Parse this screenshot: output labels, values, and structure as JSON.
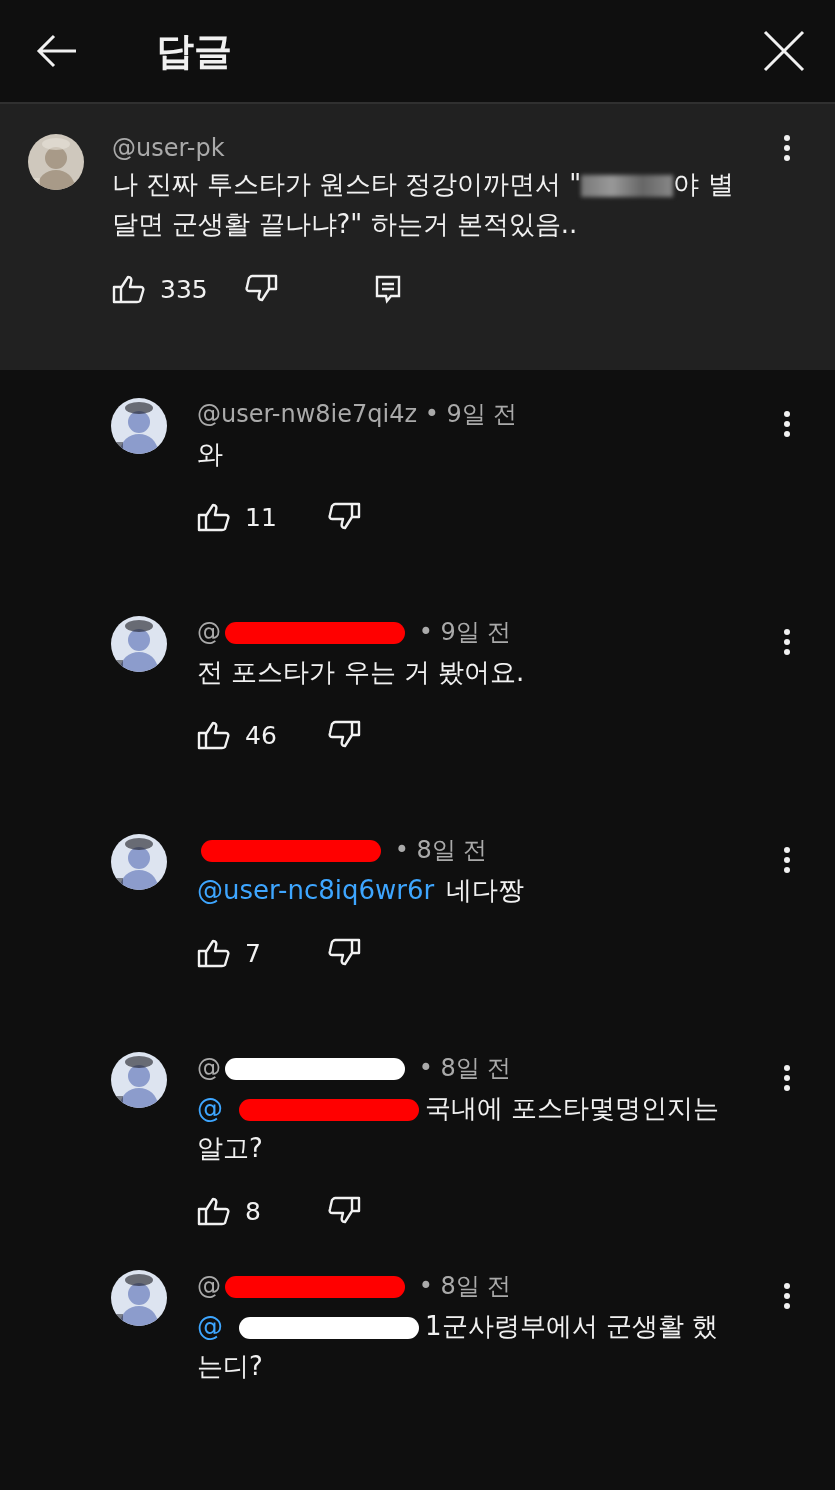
{
  "header": {
    "title": "답글"
  },
  "parent": {
    "author": "@user-pk",
    "text_before": "나 진짜 투스타가 원스타 정강이까면서 \"",
    "blurred": true,
    "text_after": "야 별달면 군생활 끝나냐?\" 하는거 본적있음..",
    "likes": "335"
  },
  "replies": [
    {
      "author": "@user-nw8ie7qi4z",
      "time": "• 9일 전",
      "text": "와",
      "likes": "11"
    },
    {
      "author": "@",
      "author_redaction": {
        "color": "#ff0000"
      },
      "time": "• 9일 전",
      "text": "전 포스타가 우는 거 봤어요.",
      "likes": "46"
    },
    {
      "author_redaction": {
        "color": "#ff0000"
      },
      "time": "• 8일 전",
      "mention": "@user-nc8iq6wr6r",
      "text": "네다짱",
      "likes": "7"
    },
    {
      "author": "@",
      "author_redaction": {
        "color": "#ffffff"
      },
      "time": "• 8일 전",
      "mention": "@",
      "mention_redaction": {
        "color": "#ff0000"
      },
      "text": "국내에 포스타몇명인지는 알고?",
      "likes": "8"
    },
    {
      "author": "@",
      "author_redaction": {
        "color": "#ff0000"
      },
      "time": "• 8일 전",
      "mention": "@",
      "mention_redaction": {
        "color": "#ffffff"
      },
      "text": "1군사령부에서 군생활 했는디?"
    }
  ]
}
